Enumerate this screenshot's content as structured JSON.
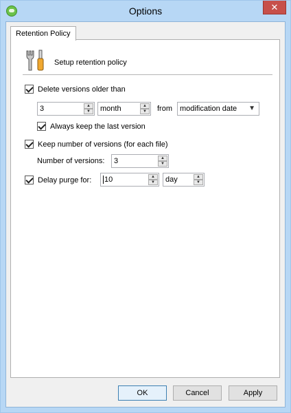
{
  "window": {
    "title": "Options",
    "close_glyph": "✕"
  },
  "tabs": [
    {
      "label": "Retention Policy"
    }
  ],
  "header": {
    "text": "Setup retention policy",
    "icon": "tools-icon"
  },
  "delete_versions": {
    "label": "Delete versions older than",
    "checked": true,
    "count": "3",
    "unit": "month",
    "from_label": "from",
    "from_value": "modification date",
    "keep_last": {
      "label": "Always keep the last version",
      "checked": true
    }
  },
  "keep_number": {
    "label": "Keep number of versions (for each file)",
    "checked": true,
    "count_label": "Number of versions:",
    "count": "3"
  },
  "delay_purge": {
    "label": "Delay purge for:",
    "checked": true,
    "count": "10",
    "unit": "day"
  },
  "buttons": {
    "ok": "OK",
    "cancel": "Cancel",
    "apply": "Apply"
  },
  "colors": {
    "title_bar": "#b7d7f5",
    "close_button": "#c7504a",
    "default_button_border": "#3c7fb1"
  }
}
